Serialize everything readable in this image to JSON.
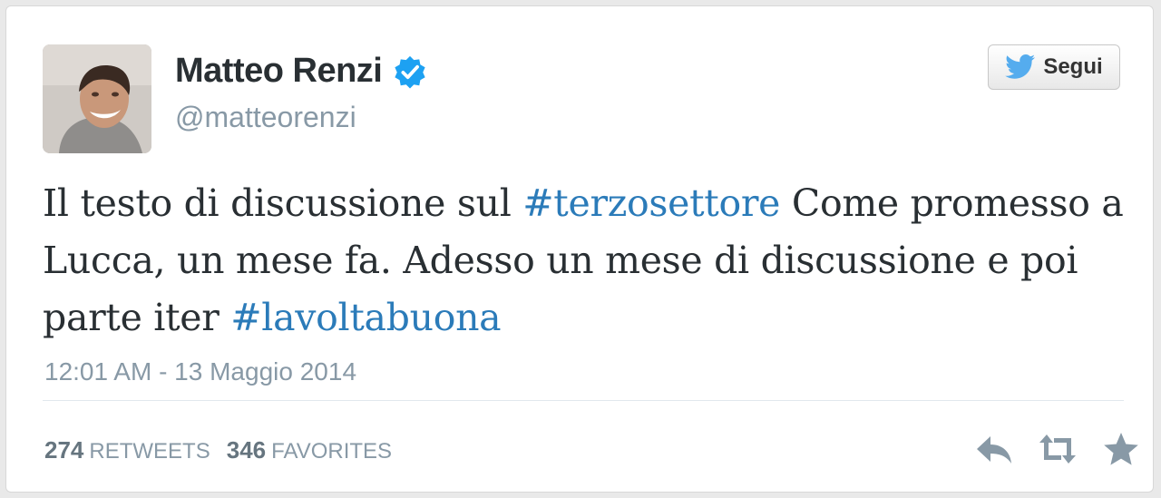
{
  "user": {
    "display_name": "Matteo Renzi",
    "handle": "@matteorenzi",
    "verified": true
  },
  "follow_button": {
    "label": "Segui"
  },
  "tweet": {
    "segments": [
      {
        "text": "Il testo di discussione sul ",
        "type": "text"
      },
      {
        "text": "#terzosettore",
        "type": "hashtag"
      },
      {
        "text": " Come promesso a Lucca, un mese fa. Adesso un mese di discussione e poi parte iter ",
        "type": "text"
      },
      {
        "text": "#lavoltabuona",
        "type": "hashtag"
      }
    ]
  },
  "timestamp": "12:01 AM - 13 Maggio 2014",
  "stats": {
    "retweets_count": "274",
    "retweets_label": "RETWEETS",
    "favorites_count": "346",
    "favorites_label": "FAVORITES"
  },
  "icons": {
    "verified": "verified-badge-icon",
    "follow": "twitter-bird-icon",
    "reply": "reply-icon",
    "retweet": "retweet-icon",
    "favorite": "star-icon"
  },
  "colors": {
    "hashtag": "#2b7bb9",
    "verified": "#1da1f2",
    "bird": "#55acee",
    "muted": "#8899a6",
    "action_icon": "#8899a6"
  }
}
